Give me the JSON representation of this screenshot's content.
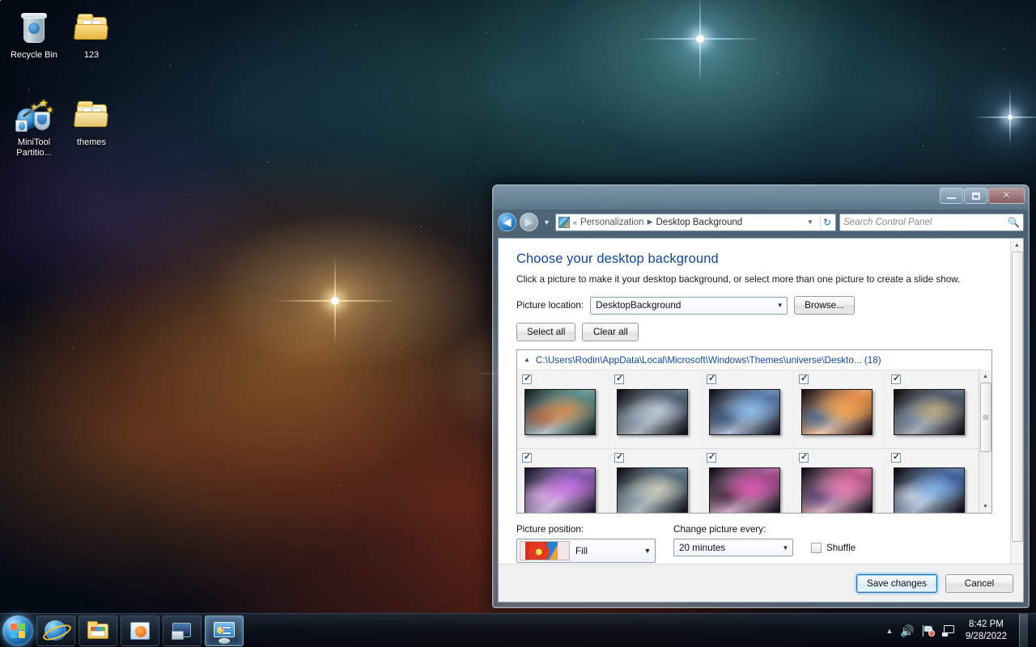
{
  "desktop": {
    "icons": [
      {
        "name": "Recycle Bin",
        "icon": "recycle-bin-icon"
      },
      {
        "name": "123",
        "icon": "folder-icon"
      },
      {
        "name": "MiniTool Partitio...",
        "icon": "minitool-partition-wizard-icon"
      },
      {
        "name": "themes",
        "icon": "folder-icon"
      }
    ]
  },
  "window": {
    "title": "",
    "controls": {
      "minimize": "–",
      "maximize": "□",
      "close": "✕"
    },
    "nav": {
      "back": "back-arrow",
      "forward": "forward-arrow",
      "history_dropdown": "▼",
      "breadcrumb_prefix": "«",
      "breadcrumbs": [
        "Personalization",
        "Desktop Background"
      ],
      "breadcrumb_separator": "▶",
      "address_dropdown": "▼",
      "refresh": "refresh-icon"
    },
    "search": {
      "placeholder": "Search Control Panel",
      "value": "",
      "icon": "search-icon"
    }
  },
  "page": {
    "heading": "Choose your desktop background",
    "subtext": "Click a picture to make it your desktop background, or select more than one picture to create a slide show.",
    "picture_location_label": "Picture location:",
    "picture_location_value": "DesktopBackground",
    "browse_button": "Browse...",
    "select_all_button": "Select all",
    "clear_all_button": "Clear all",
    "group": {
      "expander": "▲",
      "path": "C:\\Users\\Rodin\\AppData\\Local\\Microsoft\\Windows\\Themes\\universe\\Deskto... (18)",
      "count": 18
    },
    "thumbnails": [
      {
        "checked": true,
        "colors": [
          "#0b1a1c",
          "#2d6f6a",
          "#e0863a",
          "#c8501d"
        ]
      },
      {
        "checked": true,
        "colors": [
          "#05070f",
          "#1d3550",
          "#cfd8e6",
          "#8fa5bd"
        ]
      },
      {
        "checked": true,
        "colors": [
          "#060a18",
          "#2a5694",
          "#8fc4f2",
          "#1b3c6e"
        ]
      },
      {
        "checked": true,
        "colors": [
          "#120806",
          "#e2701a",
          "#f0a247",
          "#1d5ba0"
        ]
      },
      {
        "checked": true,
        "colors": [
          "#05070c",
          "#1a2c44",
          "#c8b07a",
          "#6e8aa8"
        ]
      },
      {
        "checked": true,
        "colors": [
          "#150b28",
          "#6a2fa0",
          "#d16fe8",
          "#f0b8f5"
        ]
      },
      {
        "checked": true,
        "colors": [
          "#040810",
          "#2b4a5e",
          "#ddd6bc",
          "#8aa7b8"
        ]
      },
      {
        "checked": true,
        "colors": [
          "#0d0412",
          "#8a1f6e",
          "#e04ab0",
          "#2a0a1c"
        ]
      },
      {
        "checked": true,
        "colors": [
          "#0a0510",
          "#b5306e",
          "#e87ab0",
          "#3a2a6e"
        ]
      },
      {
        "checked": true,
        "colors": [
          "#01030c",
          "#0d3a82",
          "#7fb8f0",
          "#e8f2ff"
        ]
      }
    ],
    "picture_position_label": "Picture position:",
    "picture_position_value": "Fill",
    "change_picture_label": "Change picture every:",
    "change_picture_value": "20 minutes",
    "shuffle_label": "Shuffle",
    "shuffle_checked": false,
    "save_button": "Save changes",
    "cancel_button": "Cancel"
  },
  "taskbar": {
    "start": "start-orb",
    "items": [
      {
        "name": "internet-explorer",
        "active": false
      },
      {
        "name": "windows-explorer",
        "active": false
      },
      {
        "name": "windows-media-player",
        "active": false
      },
      {
        "name": "application",
        "active": false
      },
      {
        "name": "personalization-control-panel",
        "active": true
      }
    ],
    "tray": {
      "show_hidden": "▲",
      "volume": "volume-icon",
      "action-center": "flag-icon",
      "network": "network-icon"
    },
    "clock": {
      "time": "8:42 PM",
      "date": "9/28/2022"
    }
  }
}
